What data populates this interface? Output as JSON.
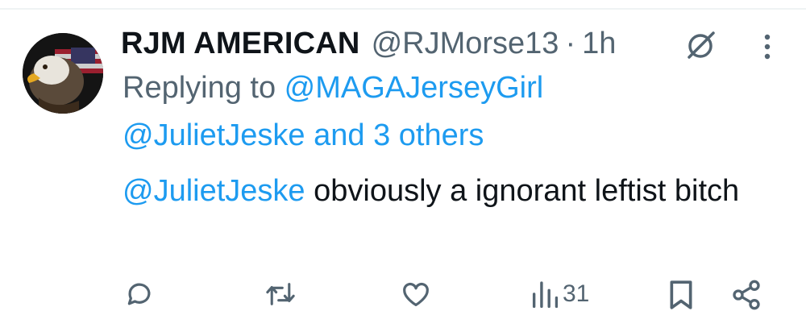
{
  "tweet": {
    "author_name": "RJM AMERICAN",
    "handle": "@RJMorse13",
    "separator": "·",
    "time": "1h",
    "replying_prefix": "Replying to ",
    "reply_to_1": "@MAGAJerseyGirl",
    "reply_to_2": "@JulietJeske",
    "reply_and_others": " and 3 others",
    "mention": "@JulietJeske",
    "body": " obviously a ignorant leftist bitch",
    "avatar_icon": "eagle-flag-avatar"
  },
  "actions": {
    "reply_icon": "reply-icon",
    "retweet_icon": "retweet-icon",
    "like_icon": "heart-icon",
    "views_icon": "views-icon",
    "views_count": "31",
    "bookmark_icon": "bookmark-icon",
    "share_icon": "share-icon"
  },
  "colors": {
    "link": "#1d9bf0",
    "muted": "#536471",
    "text": "#0f1419"
  }
}
